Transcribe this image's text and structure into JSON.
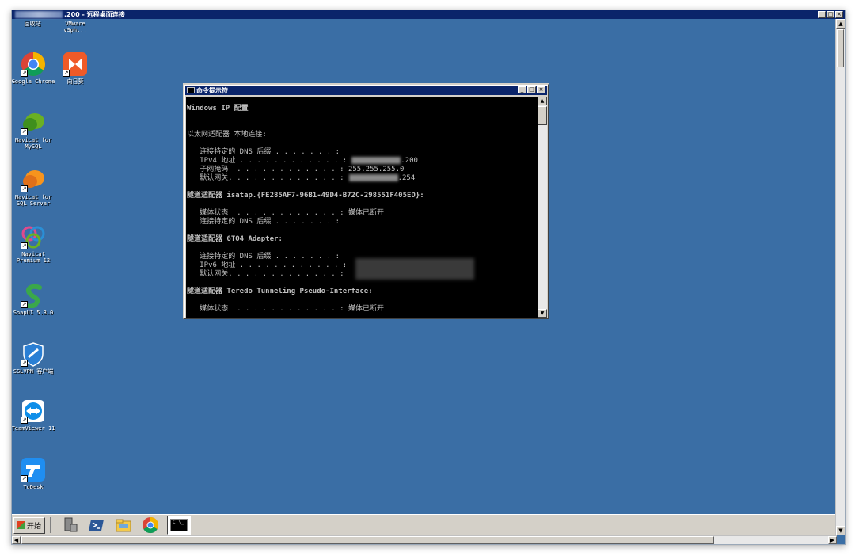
{
  "window": {
    "title": ".200 - 远程桌面连接",
    "controls": [
      "_",
      "□",
      "×"
    ]
  },
  "desktop_icons": [
    {
      "label": "回收站",
      "icon": "recycle-bin-icon"
    },
    {
      "label": "VMware vSph...",
      "icon": "vmware-icon"
    },
    {
      "label": "Google Chrome",
      "icon": "chrome-icon"
    },
    {
      "label": "向日葵",
      "icon": "sunlogin-icon"
    },
    {
      "label": "Navicat for MySQL",
      "icon": "navicat-mysql-icon"
    },
    {
      "label": "Navicat for SQL Server",
      "icon": "navicat-sqlserver-icon"
    },
    {
      "label": "Navicat Premium 12",
      "icon": "navicat-premium-icon"
    },
    {
      "label": "SoapUI 5.3.0",
      "icon": "soapui-icon"
    },
    {
      "label": "SSLVPN 客户端",
      "icon": "sslvpn-icon"
    },
    {
      "label": "TeamViewer 11",
      "icon": "teamviewer-icon"
    },
    {
      "label": "ToDesk",
      "icon": "todesk-icon"
    }
  ],
  "cmd": {
    "title": "命令提示符",
    "lines": [
      {
        "text": "Windows IP 配置",
        "bold": true
      },
      {
        "text": "",
        "bold": false
      },
      {
        "text": "",
        "bold": false
      },
      {
        "text": "以太网适配器 本地连接:",
        "bold": false
      },
      {
        "text": "",
        "bold": false
      },
      {
        "text": "   连接特定的 DNS 后缀 . . . . . . . :",
        "bold": false
      },
      {
        "text": "   IPv4 地址 . . . . . . . . . . . . :",
        "bold": false,
        "redacted": true,
        "suffix": ".200"
      },
      {
        "text": "   子网掩码  . . . . . . . . . . . . : 255.255.255.0",
        "bold": false
      },
      {
        "text": "   默认网关. . . . . . . . . . . . . :",
        "bold": false,
        "redacted": true,
        "suffix": ".254"
      },
      {
        "text": "",
        "bold": false
      },
      {
        "text": "隧道适配器 isatap.{FE285AF7-96B1-49D4-B72C-298551F405ED}:",
        "bold": true
      },
      {
        "text": "",
        "bold": false
      },
      {
        "text": "   媒体状态  . . . . . . . . . . . . : 媒体已断开",
        "bold": false
      },
      {
        "text": "   连接特定的 DNS 后缀 . . . . . . . :",
        "bold": false
      },
      {
        "text": "",
        "bold": false
      },
      {
        "text": "隧道适配器 6TO4 Adapter:",
        "bold": true
      },
      {
        "text": "",
        "bold": false
      },
      {
        "text": "   连接特定的 DNS 后缀 . . . . . . . :",
        "bold": false
      },
      {
        "text": "   IPv6 地址 . . . . . . . . . . . . :",
        "bold": false
      },
      {
        "text": "   默认网关. . . . . . . . . . . . . :",
        "bold": false
      },
      {
        "text": "",
        "bold": false
      },
      {
        "text": "隧道适配器 Teredo Tunneling Pseudo-Interface:",
        "bold": true
      },
      {
        "text": "",
        "bold": false
      },
      {
        "text": "   媒体状态  . . . . . . . . . . . . : 媒体已断开",
        "bold": false
      }
    ]
  },
  "taskbar": {
    "start_label": "开始",
    "items": [
      "server-manager-icon",
      "powershell-icon",
      "explorer-icon",
      "chrome-icon",
      "cmd-icon"
    ],
    "active_icon_text": "C:\\_"
  },
  "colors": {
    "desktop": "#3a6ea5",
    "titlebar": "#0a246a",
    "console_bg": "#000000",
    "console_fg": "#c0c0c0"
  }
}
